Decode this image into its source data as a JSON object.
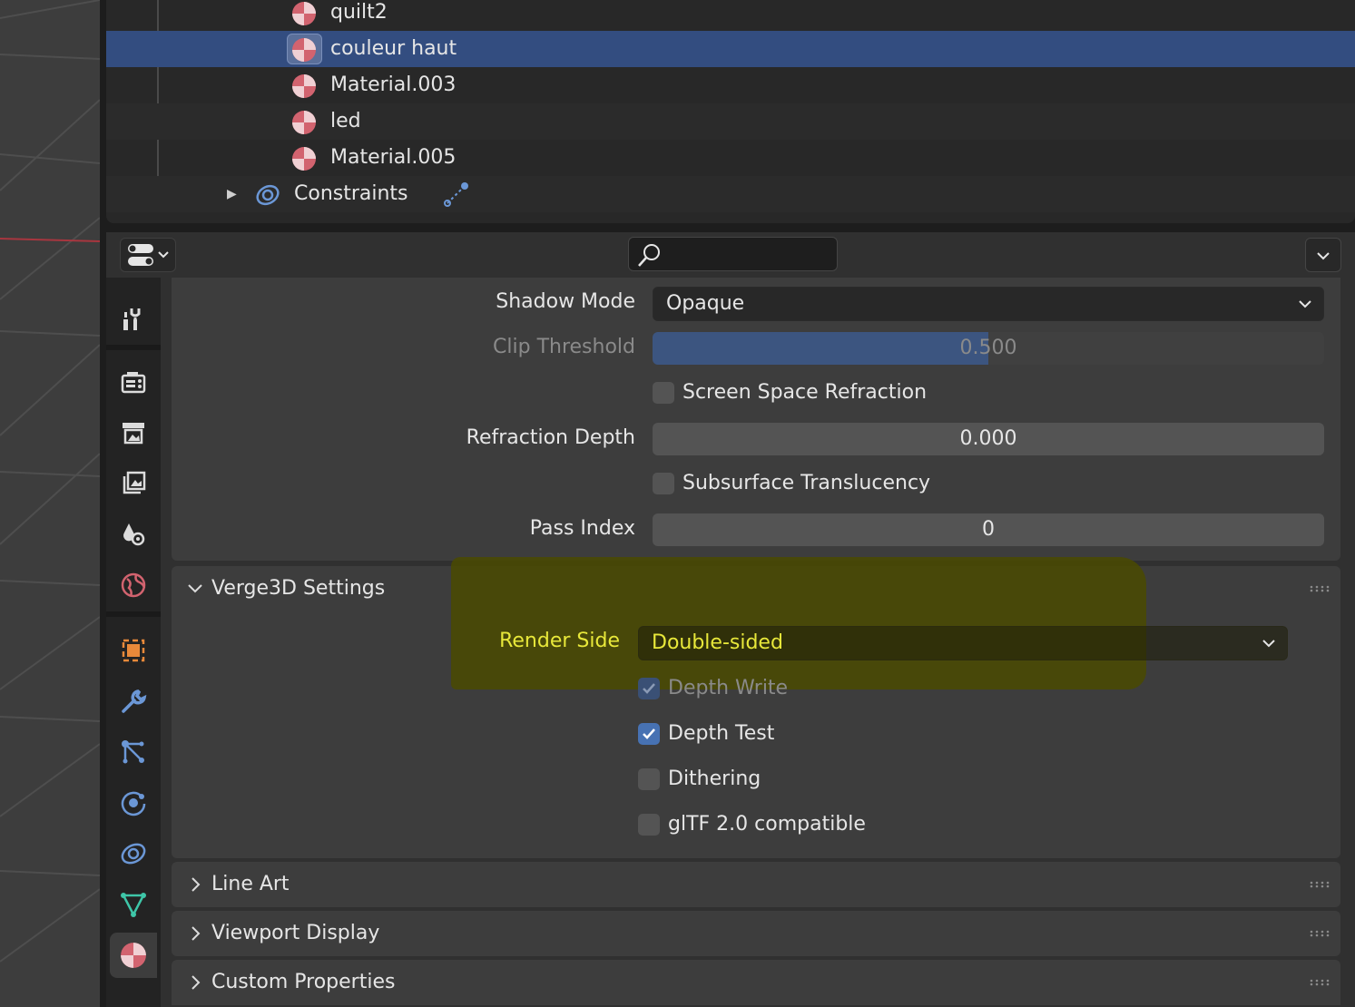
{
  "outliner": {
    "rows": [
      {
        "label": "quilt2",
        "selected": false
      },
      {
        "label": "couleur haut",
        "selected": true
      },
      {
        "label": "Material.003",
        "selected": false
      },
      {
        "label": "led",
        "selected": false
      },
      {
        "label": "Material.005",
        "selected": false
      }
    ],
    "constraints_label": "Constraints"
  },
  "header": {
    "search_placeholder": ""
  },
  "material": {
    "shadow_mode_label": "Shadow Mode",
    "shadow_mode_value": "Opaque",
    "clip_threshold_label": "Clip Threshold",
    "clip_threshold_value": "0.500",
    "clip_threshold_fraction": 0.5,
    "ssr_label": "Screen Space Refraction",
    "ssr_checked": false,
    "refraction_depth_label": "Refraction Depth",
    "refraction_depth_value": "0.000",
    "subsurface_label": "Subsurface Translucency",
    "subsurface_checked": false,
    "pass_index_label": "Pass Index",
    "pass_index_value": "0"
  },
  "verge3d": {
    "title": "Verge3D Settings",
    "render_side_label": "Render Side",
    "render_side_value": "Double-sided",
    "depth_write_label": "Depth Write",
    "depth_write_checked": true,
    "depth_test_label": "Depth Test",
    "depth_test_checked": true,
    "dithering_label": "Dithering",
    "dithering_checked": false,
    "gltf_label": "glTF 2.0 compatible",
    "gltf_checked": false
  },
  "collapsed_panels": [
    {
      "title": "Line Art"
    },
    {
      "title": "Viewport Display"
    },
    {
      "title": "Custom Properties"
    }
  ],
  "colors": {
    "accent": "#4772b3",
    "selection": "#334d80",
    "highlight": "#e8e83a",
    "material_icon": "#d2636f"
  },
  "tab_icons": [
    "tool-icon",
    "render-icon",
    "output-icon",
    "view-layer-icon",
    "scene-icon",
    "world-icon",
    "object-icon",
    "modifier-icon",
    "particles-icon",
    "physics-icon",
    "constraints-icon",
    "data-icon",
    "material-icon"
  ]
}
